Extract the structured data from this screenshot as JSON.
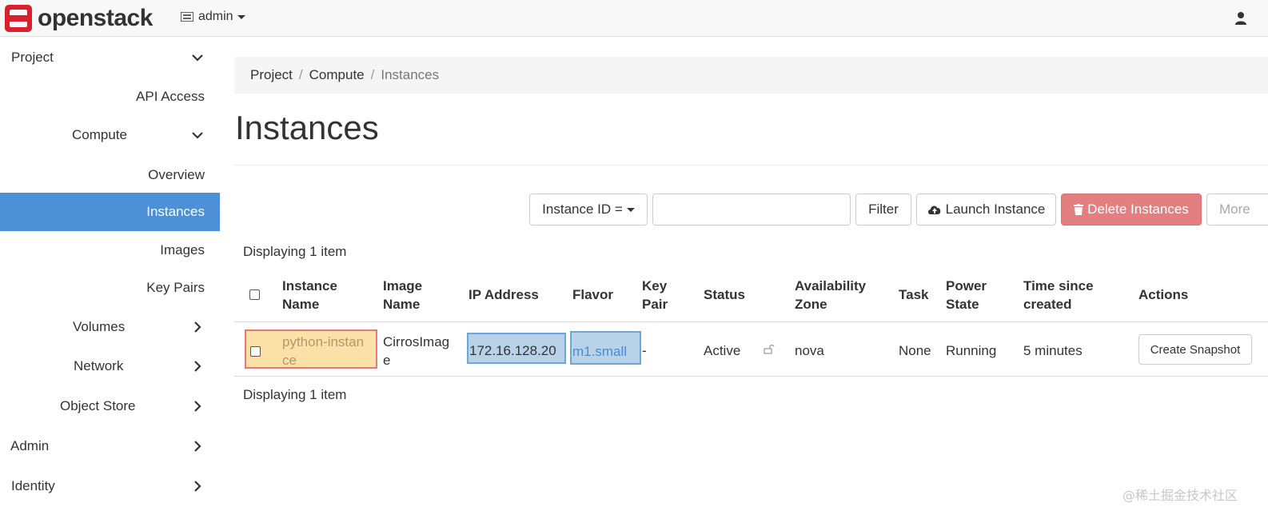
{
  "navbar": {
    "brand": "openstack",
    "project_label": "admin"
  },
  "sidebar": {
    "items": [
      {
        "label": "Project"
      },
      {
        "label": "API Access"
      },
      {
        "label": "Compute"
      },
      {
        "label": "Overview"
      },
      {
        "label": "Instances"
      },
      {
        "label": "Images"
      },
      {
        "label": "Key Pairs"
      },
      {
        "label": "Volumes"
      },
      {
        "label": "Network"
      },
      {
        "label": "Object Store"
      },
      {
        "label": "Admin"
      },
      {
        "label": "Identity"
      }
    ]
  },
  "breadcrumb": {
    "items": [
      "Project",
      "Compute",
      "Instances"
    ]
  },
  "page": {
    "title": "Instances"
  },
  "toolbar": {
    "filter_field_label": "Instance ID =",
    "filter_value": "",
    "filter_button": "Filter",
    "launch_button": "Launch Instance",
    "delete_button": "Delete Instances",
    "more_button": "More"
  },
  "table": {
    "count_label": "Displaying 1 item",
    "headers": {
      "instance_name": [
        "Instance",
        "Name"
      ],
      "image_name": [
        "Image",
        "Name"
      ],
      "ip_address": "IP Address",
      "flavor": "Flavor",
      "key_pair": [
        "Key",
        "Pair"
      ],
      "status": "Status",
      "availability_zone": [
        "Availability",
        "Zone"
      ],
      "task": "Task",
      "power_state": [
        "Power",
        "State"
      ],
      "time_since_created": [
        "Time since",
        "created"
      ],
      "actions": "Actions"
    },
    "rows": [
      {
        "instance_name": [
          "python-instan",
          "ce"
        ],
        "image_name": [
          "CirrosImag",
          "e"
        ],
        "ip_address": "172.16.128.20",
        "flavor": "m1.small",
        "key_pair": "-",
        "status": "Active",
        "availability_zone": "nova",
        "task": "None",
        "power_state": "Running",
        "time_since_created": "5 minutes",
        "action_button": "Create Snapshot"
      }
    ]
  },
  "watermark": "@稀土掘金技术社区",
  "colors": {
    "active_nav": "#4d90d6",
    "danger": "#e37f80",
    "brand_red": "#d9202d"
  }
}
